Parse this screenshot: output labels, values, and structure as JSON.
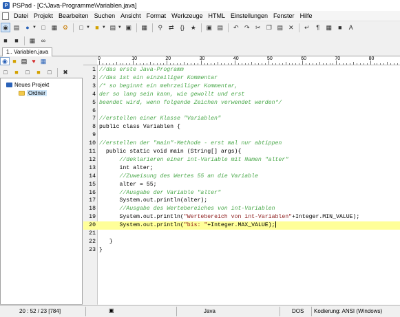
{
  "window": {
    "title": "PSPad - [C:\\Java-Programme\\Variablen.java]",
    "app_icon_letter": "P"
  },
  "menu": [
    "Datei",
    "Projekt",
    "Bearbeiten",
    "Suchen",
    "Ansicht",
    "Format",
    "Werkzeuge",
    "HTML",
    "Einstellungen",
    "Fenster",
    "Hilfe"
  ],
  "file_tab": "1.. Variablen.java",
  "project_tree": {
    "root": "Neues Projekt",
    "child": "Ordner"
  },
  "ruler_labels": [
    "0",
    "10",
    "20",
    "30",
    "40",
    "50",
    "60",
    "70",
    "80"
  ],
  "code_lines": [
    {
      "n": "1",
      "text": "//das erste Java-Programm",
      "kind": "comment"
    },
    {
      "n": "2",
      "text": "//das ist ein einzeiliger Kommentar",
      "kind": "comment"
    },
    {
      "n": "3",
      "text": "/* so beginnt ein mehrzeiliger Kommentar,",
      "kind": "comment"
    },
    {
      "n": "4",
      "text": "der so lang sein kann, wie gewollt und erst",
      "kind": "comment"
    },
    {
      "n": "5",
      "text": "beendet wird, wenn folgende Zeichen verwendet werden*/",
      "kind": "comment"
    },
    {
      "n": "6",
      "text": "",
      "kind": "plain"
    },
    {
      "n": "7",
      "text": "//erstellen einer Klasse \"Variablen\"",
      "kind": "comment"
    },
    {
      "n": "8",
      "text": "public class Variablen {",
      "kind": "plain"
    },
    {
      "n": "9",
      "text": "",
      "kind": "plain"
    },
    {
      "n": "10",
      "text": "//erstellen der \"main\"-Methode - erst mal nur abtippen",
      "kind": "comment"
    },
    {
      "n": "11",
      "text": "  public static void main (String[] args){",
      "kind": "plain"
    },
    {
      "n": "12",
      "text": "      //deklarieren einer int-Variable mit Namen \"alter\"",
      "kind": "comment"
    },
    {
      "n": "13",
      "text": "      int alter;",
      "kind": "plain"
    },
    {
      "n": "14",
      "text": "      //Zuweisung des Wertes 55 an die Variable",
      "kind": "comment"
    },
    {
      "n": "15",
      "text": "      alter = 55;",
      "kind": "plain"
    },
    {
      "n": "16",
      "text": "      //Ausgabe der Variable \"alter\"",
      "kind": "comment"
    },
    {
      "n": "17",
      "text": "      System.out.println(alter);",
      "kind": "plain"
    },
    {
      "n": "18",
      "text": "      //Ausgabe des Wertebereiches von int-Variablen",
      "kind": "comment"
    },
    {
      "n": "19",
      "pre": "      System.out.println(",
      "str": "\"Wertebereich von int-Variablen\"",
      "post": "+Integer.MIN_VALUE);",
      "kind": "mixed"
    },
    {
      "n": "20",
      "pre": "      System.out.println(",
      "str": "\"bis: \"",
      "post": "+Integer.MAX_VALUE);",
      "kind": "mixed",
      "current": true
    },
    {
      "n": "21",
      "text": "",
      "kind": "plain"
    },
    {
      "n": "22",
      "text": "   }",
      "kind": "plain"
    },
    {
      "n": "23",
      "text": "}",
      "kind": "plain"
    }
  ],
  "status": {
    "position": "20 : 52 / 23 [784]",
    "language": "Java",
    "line_ending": "DOS",
    "encoding": "Kodierung: ANSI (Windows)"
  },
  "colors": {
    "comment": "#4aa84a",
    "string": "#8b1a1a",
    "current_line": "#ffff99",
    "selection": "#cce4f7"
  }
}
